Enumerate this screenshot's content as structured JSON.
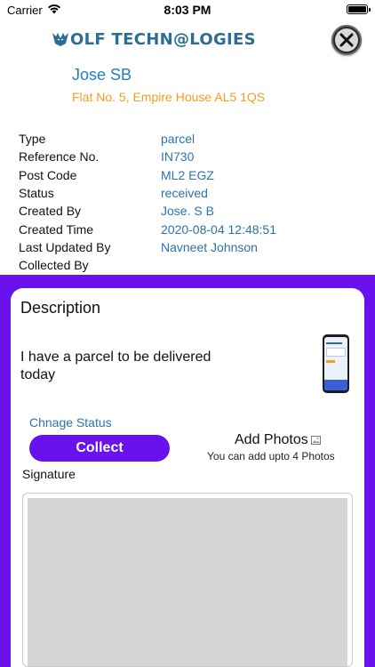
{
  "status_bar": {
    "carrier": "Carrier",
    "time": "8:03 PM"
  },
  "header": {
    "logo_text": "OLF TECHN@LOGIES"
  },
  "customer": {
    "name": "Jose SB",
    "address": "Flat No. 5, Empire House AL5 1QS"
  },
  "details": [
    {
      "label": "Type",
      "value": "parcel"
    },
    {
      "label": "Reference No.",
      "value": "IN730"
    },
    {
      "label": "Post Code",
      "value": "ML2 EGZ"
    },
    {
      "label": "Status",
      "value": "received"
    },
    {
      "label": "Created By",
      "value": "Jose. S B"
    },
    {
      "label": "Created Time",
      "value": "2020-08-04 12:48:51"
    },
    {
      "label": "Last Updated By",
      "value": "Navneet Johnson"
    },
    {
      "label": "Collected By",
      "value": ""
    }
  ],
  "card": {
    "title": "Description",
    "text": "I have a parcel to be delivered today",
    "change_status_label": "Chnage Status",
    "collect_label": "Collect",
    "add_photos_label": "Add Photos",
    "photos_hint": "You can add upto 4 Photos",
    "signature_label": "Signature"
  },
  "colors": {
    "accent": "#6a12ee",
    "link": "#2d73ad",
    "name": "#1f7fc2",
    "address": "#f0a01c"
  }
}
